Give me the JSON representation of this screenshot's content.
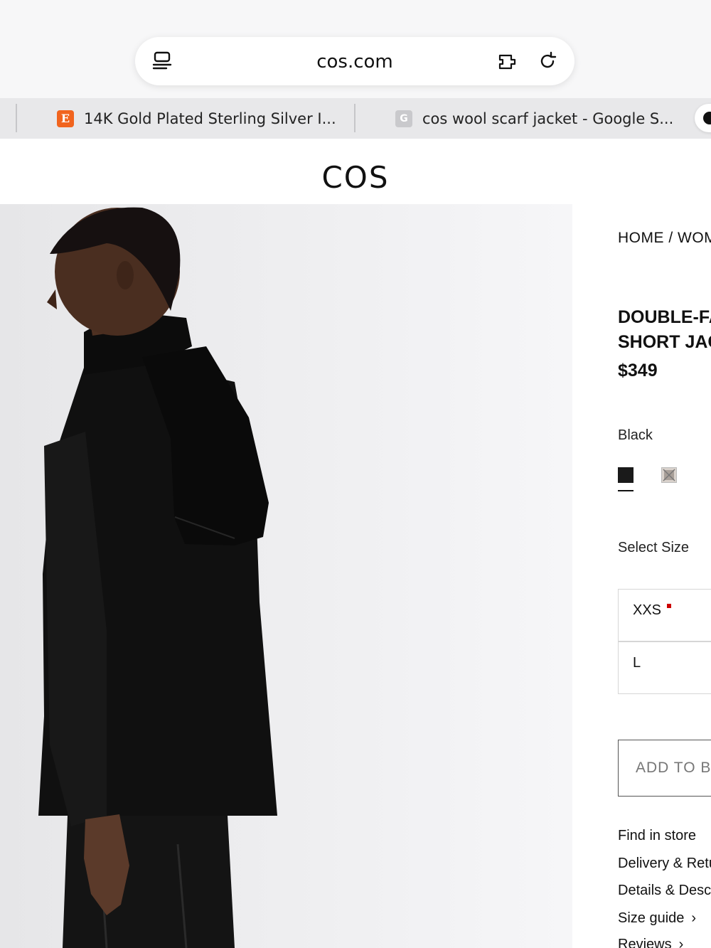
{
  "browser": {
    "url": "cos.com",
    "tabs": [
      {
        "favicon_letter": "E",
        "title": "14K Gold Plated Sterling Silver I..."
      },
      {
        "favicon_letter": "G",
        "title": "cos wool scarf jacket - Google S..."
      }
    ],
    "icons": {
      "left": "tabs-overview-icon",
      "right_1": "extension-icon",
      "right_2": "reload-icon"
    }
  },
  "site": {
    "logo": "COS"
  },
  "product": {
    "breadcrumb": "HOME / WOMEN",
    "title_line1": "DOUBLE-FACED",
    "title_line2": "SHORT JACKET",
    "price": "$349",
    "color_name": "Black",
    "colors": {
      "selected": "#1a1a1a",
      "alternate": "#d9d2cc"
    },
    "select_size_label": "Select Size",
    "sizes": [
      {
        "label": "XXS",
        "low_stock": true
      },
      {
        "label": "L",
        "low_stock": false
      }
    ],
    "add_to_bag": "ADD TO BAG",
    "links": {
      "find_in_store": "Find in store",
      "delivery": "Delivery & Returns",
      "details": "Details & Description",
      "size_guide": "Size guide",
      "reviews": "Reviews"
    }
  }
}
